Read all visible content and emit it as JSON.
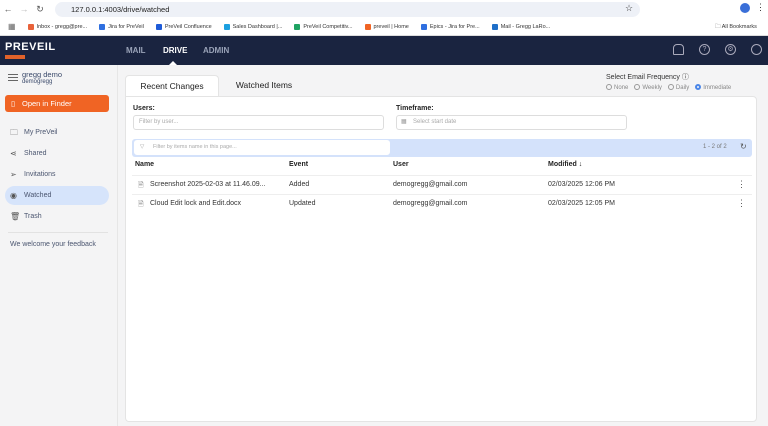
{
  "browser": {
    "url": "127.0.0.1:4003/drive/watched",
    "bookmarks": [
      {
        "label": "Inbox - gregg@pre...",
        "color": "#e8623a"
      },
      {
        "label": "Jira for PreVeil",
        "color": "#2f6fe0"
      },
      {
        "label": "PreVeil Confluence",
        "color": "#1e5bd8"
      },
      {
        "label": "Sales Dashboard |...",
        "color": "#1ca0e0"
      },
      {
        "label": "PreVeil Competitiv...",
        "color": "#1ea362"
      },
      {
        "label": "preveil | Home",
        "color": "#f06424"
      },
      {
        "label": "Epics - Jira for Pre...",
        "color": "#2f6fe0"
      },
      {
        "label": "Mail - Gregg LaRo...",
        "color": "#1e6fc8"
      }
    ],
    "all_bookmarks": "All Bookmarks"
  },
  "header": {
    "logo": "PREVEIL",
    "tabs": [
      "MAIL",
      "DRIVE",
      "ADMIN"
    ],
    "active_tab": "DRIVE"
  },
  "sidebar": {
    "user_name": "gregg demo",
    "user_id": "demogregg",
    "open_finder": "Open in Finder",
    "items": [
      {
        "label": "My PreVeil",
        "icon": "folder-icon"
      },
      {
        "label": "Shared",
        "icon": "share-icon"
      },
      {
        "label": "Invitations",
        "icon": "send-icon"
      },
      {
        "label": "Watched",
        "icon": "eye-icon",
        "active": true
      },
      {
        "label": "Trash",
        "icon": "trash-icon"
      }
    ],
    "feedback": "We welcome your feedback"
  },
  "main": {
    "tabs": [
      "Recent Changes",
      "Watched Items"
    ],
    "email_frequency": {
      "label": "Select Email Frequency",
      "options": [
        "None",
        "Weekly",
        "Daily",
        "Immediate"
      ],
      "selected": "Immediate"
    },
    "users_label": "Users:",
    "users_placeholder": "Filter by user...",
    "timeframe_label": "Timeframe:",
    "timeframe_placeholder": "Select start date",
    "filter_placeholder": "Filter by items name in this page...",
    "pagination": "1 - 2 of 2",
    "columns": [
      "Name",
      "Event",
      "User",
      "Modified ↓"
    ],
    "rows": [
      {
        "name": "Screenshot 2025-02-03 at 11.46.09...",
        "event": "Added",
        "user": "demogregg@gmail.com",
        "modified": "02/03/2025 12:06 PM"
      },
      {
        "name": "Cloud Edit lock and Edit.docx",
        "event": "Updated",
        "user": "demogregg@gmail.com",
        "modified": "02/03/2025 12:05 PM"
      }
    ]
  }
}
